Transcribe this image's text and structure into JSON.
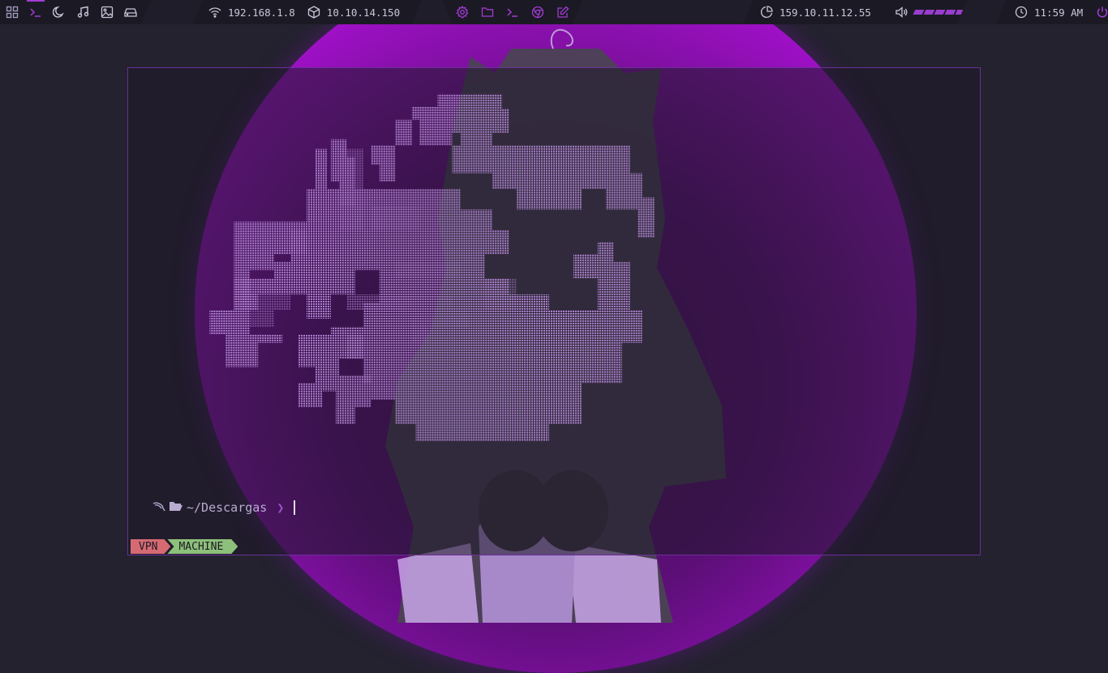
{
  "topbar": {
    "left_icons": [
      "grid-icon",
      "terminal-icon",
      "moon-icon",
      "music-icon",
      "image-icon",
      "drive-icon"
    ],
    "network": {
      "wifi_ip": "192.168.1.8",
      "target_ip": "10.10.14.150"
    },
    "apps": [
      "gear-icon",
      "folder-icon",
      "terminal-icon",
      "browser-icon",
      "edit-icon"
    ],
    "system": {
      "public_ip": "159.10.11.12.55",
      "volume_level": 1.0
    },
    "clock": {
      "time": "11:59 AM"
    }
  },
  "terminal": {
    "prompt_path": "~/Descargas",
    "prompt_chevron": "❯",
    "status": {
      "vpn_label": "VPN",
      "machine_label": "MACHINE"
    }
  },
  "colors": {
    "accent": "#a23bd4",
    "vpn_badge": "#d56a73",
    "machine_badge": "#8dc07a",
    "ascii_art": "#b488d6"
  }
}
